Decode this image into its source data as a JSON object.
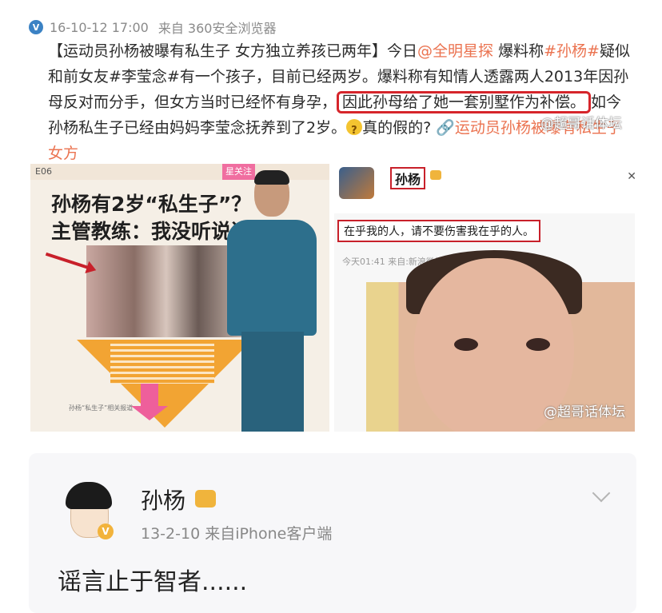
{
  "post": {
    "meta": {
      "timestamp": "16-10-12 17:00",
      "source": "来自 360安全浏览器"
    },
    "body": {
      "part1": "【运动员孙杨被曝有私生子 女方独立养孩已两年】今日",
      "mention": "@全明星探",
      "part2": " 爆料称",
      "tag1": "#孙杨#",
      "part3": "疑似和前女友#李莹念#有一个孩子，目前已经两岁。爆料称有知情人透露两人2013年因孙母反对而分手，但女方当时已经怀有身孕，",
      "highlight": "因此孙母给了她一套别墅作为补偿。",
      "part4": "如今孙杨私生子已经由妈妈李莹念抚养到了2岁。",
      "part5": "真的假的?",
      "link": "运动员孙杨被曝有私生子 女方"
    },
    "watermark": "@超哥话体坛"
  },
  "images": {
    "left": {
      "header": "E06",
      "star_tag": "星关注",
      "title_line1": "孙杨有2岁“私生子”？",
      "title_line2": "主管教练：我没听说过",
      "caption": "孙杨“私生子”相关报道"
    },
    "right": {
      "name": "孙杨",
      "quote": "在乎我的人，请不要伤害我在乎的人。",
      "time": "今天01:41  来自:新浪微博手机版",
      "watermark": "@超哥话体坛"
    }
  },
  "card": {
    "name": "孙杨",
    "meta": "13-2-10  来自iPhone客户端",
    "text": "谣言止于智者......"
  },
  "colors": {
    "accent_orange": "#eb7350",
    "highlight_red": "#d6252b",
    "verified_blue": "#3b82c4"
  }
}
